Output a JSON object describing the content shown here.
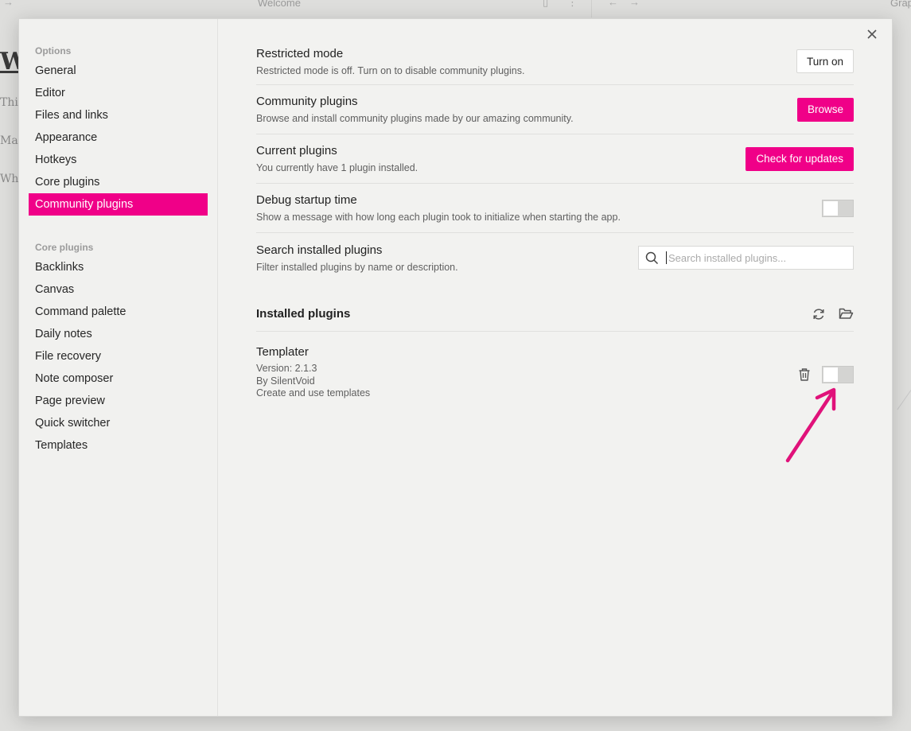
{
  "background": {
    "tab_title": "Welcome",
    "tab_title_right": "Graph",
    "doc_heading": "W",
    "doc_lines": [
      "This",
      "Mak",
      "Whe"
    ]
  },
  "sidebar": {
    "options_heading": "Options",
    "options": [
      {
        "label": "General"
      },
      {
        "label": "Editor"
      },
      {
        "label": "Files and links"
      },
      {
        "label": "Appearance"
      },
      {
        "label": "Hotkeys"
      },
      {
        "label": "Core plugins"
      },
      {
        "label": "Community plugins",
        "active": true
      }
    ],
    "core_heading": "Core plugins",
    "core_plugins": [
      {
        "label": "Backlinks"
      },
      {
        "label": "Canvas"
      },
      {
        "label": "Command palette"
      },
      {
        "label": "Daily notes"
      },
      {
        "label": "File recovery"
      },
      {
        "label": "Note composer"
      },
      {
        "label": "Page preview"
      },
      {
        "label": "Quick switcher"
      },
      {
        "label": "Templates"
      }
    ]
  },
  "settings": {
    "restricted_mode": {
      "name": "Restricted mode",
      "desc": "Restricted mode is off. Turn on to disable community plugins.",
      "button": "Turn on"
    },
    "community_plugins": {
      "name": "Community plugins",
      "desc": "Browse and install community plugins made by our amazing community.",
      "button": "Browse"
    },
    "current_plugins": {
      "name": "Current plugins",
      "desc": "You currently have 1 plugin installed.",
      "button": "Check for updates"
    },
    "debug_startup": {
      "name": "Debug startup time",
      "desc": "Show a message with how long each plugin took to initialize when starting the app.",
      "enabled": false
    },
    "search_plugins": {
      "name": "Search installed plugins",
      "desc": "Filter installed plugins by name or description.",
      "placeholder": "Search installed plugins...",
      "value": ""
    }
  },
  "installed": {
    "title": "Installed plugins",
    "plugins": [
      {
        "name": "Templater",
        "version": "Version: 2.1.3",
        "author": "By SilentVoid",
        "description": "Create and use templates",
        "enabled": false
      }
    ]
  },
  "colors": {
    "accent": "#f00088",
    "annotation_arrow": "#e0127a"
  },
  "icons": {
    "close": "close-icon",
    "search": "search-icon",
    "reload": "reload-icon",
    "folder": "folder-open-icon",
    "trash": "trash-icon"
  }
}
